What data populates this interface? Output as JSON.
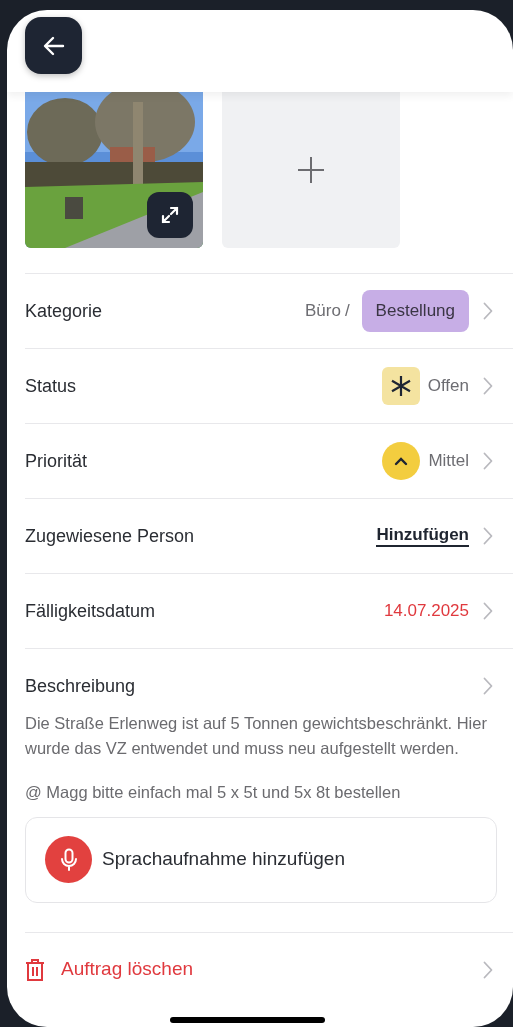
{
  "photos": [
    {
      "kind": "picture"
    },
    {
      "kind": "add"
    }
  ],
  "rows": [
    {
      "kind": "category",
      "label": "Kategorie",
      "parent": "Büro",
      "separator": "/",
      "tag": "Bestellung"
    },
    {
      "kind": "status",
      "label": "Status",
      "value": "Offen"
    },
    {
      "kind": "priority",
      "label": "Priorität",
      "value": "Mittel"
    },
    {
      "kind": "assign",
      "label": "Zugewiesene Person",
      "value": "Hinzufügen"
    },
    {
      "kind": "date",
      "label": "Fälligkeitsdatum",
      "value": "14.07.2025"
    }
  ],
  "description": {
    "label": "Beschreibung",
    "paragraphs": [
      "Die Straße Erlenweg ist auf 5 Tonnen gewichtsbeschränkt. Hier wurde das VZ entwendet und muss neu aufgestellt werden.",
      "@ Magg bitte einfach mal 5 x 5t und 5x 8t bestellen"
    ]
  },
  "voice": {
    "label": "Sprachaufnahme hinzufügen"
  },
  "delete": {
    "label": "Auftrag löschen"
  }
}
